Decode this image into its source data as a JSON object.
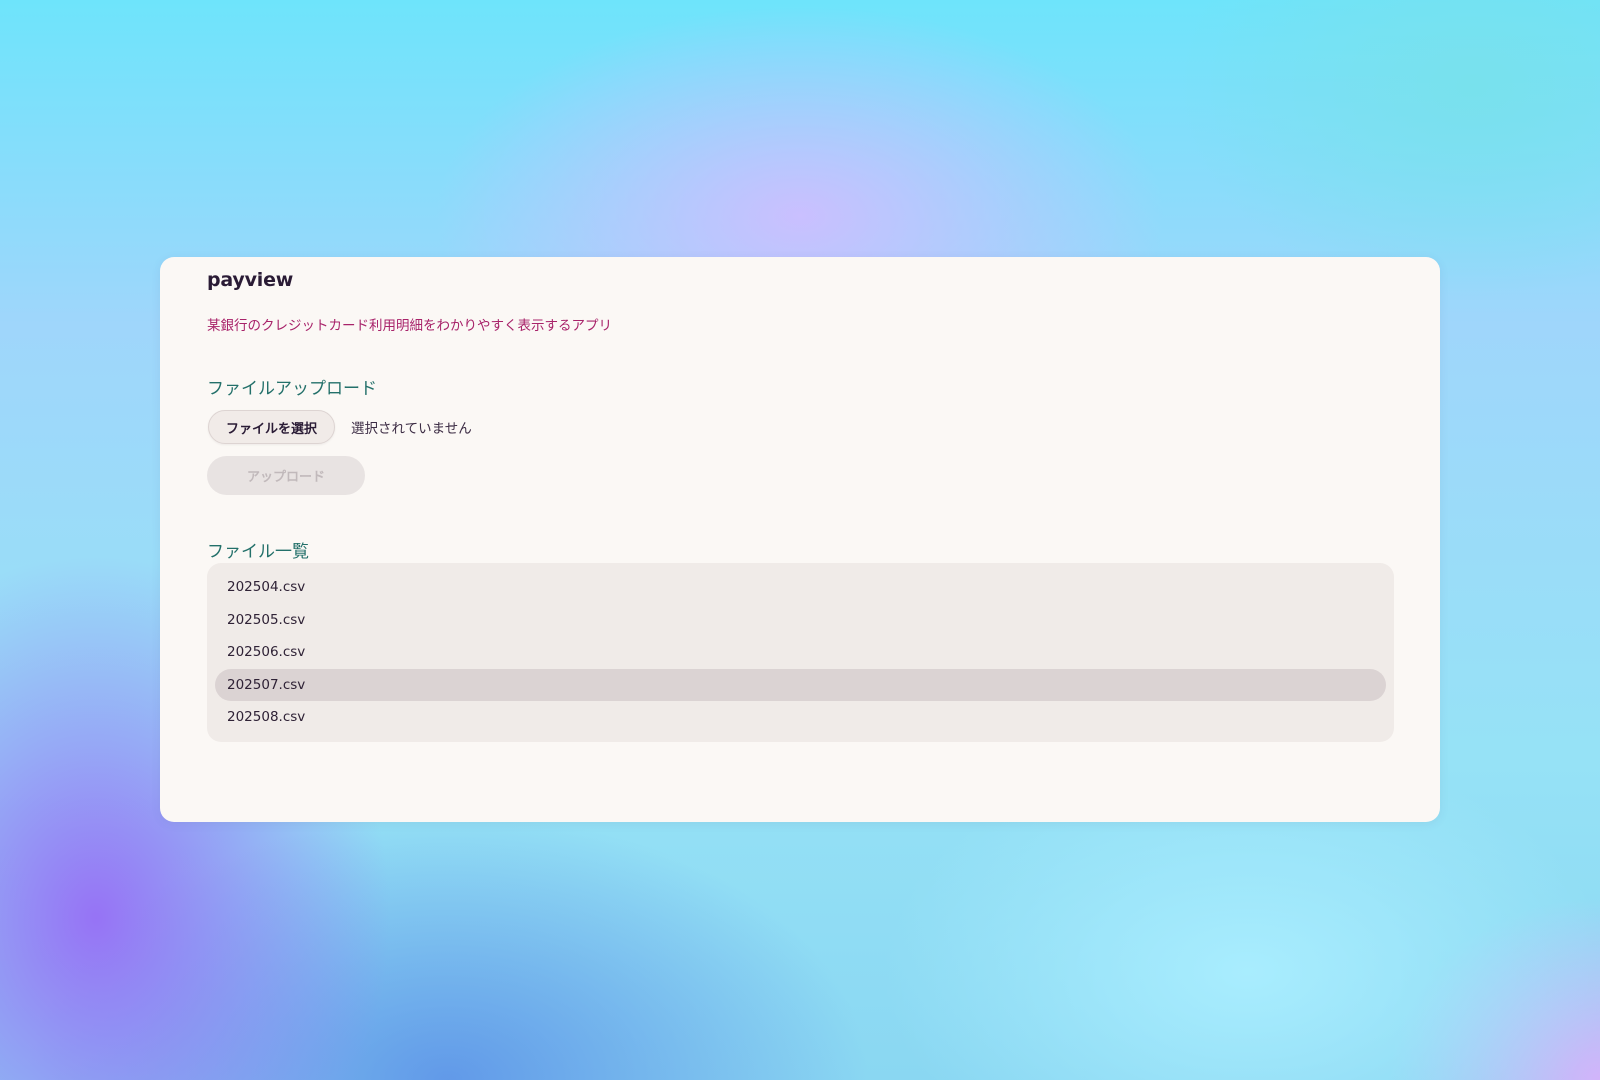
{
  "app": {
    "title": "payview",
    "subtitle": "某銀行のクレジットカード利用明細をわかりやすく表示するアプリ"
  },
  "upload_section": {
    "title": "ファイルアップロード",
    "choose_button_label": "ファイルを選択",
    "no_file_text": "選択されていません",
    "upload_button_label": "アップロード",
    "upload_button_disabled": true
  },
  "files_section": {
    "title": "ファイル一覧",
    "files": [
      {
        "name": "202504.csv",
        "selected": false
      },
      {
        "name": "202505.csv",
        "selected": false
      },
      {
        "name": "202506.csv",
        "selected": false
      },
      {
        "name": "202507.csv",
        "selected": true
      },
      {
        "name": "202508.csv",
        "selected": false
      }
    ]
  },
  "colors": {
    "title": "#2a1b35",
    "subtitle": "#a8236a",
    "section_heading": "#23706a",
    "card_background": "#fbf8f5",
    "list_background": "#f0ebe8",
    "selected_row": "#dbd3d3"
  }
}
